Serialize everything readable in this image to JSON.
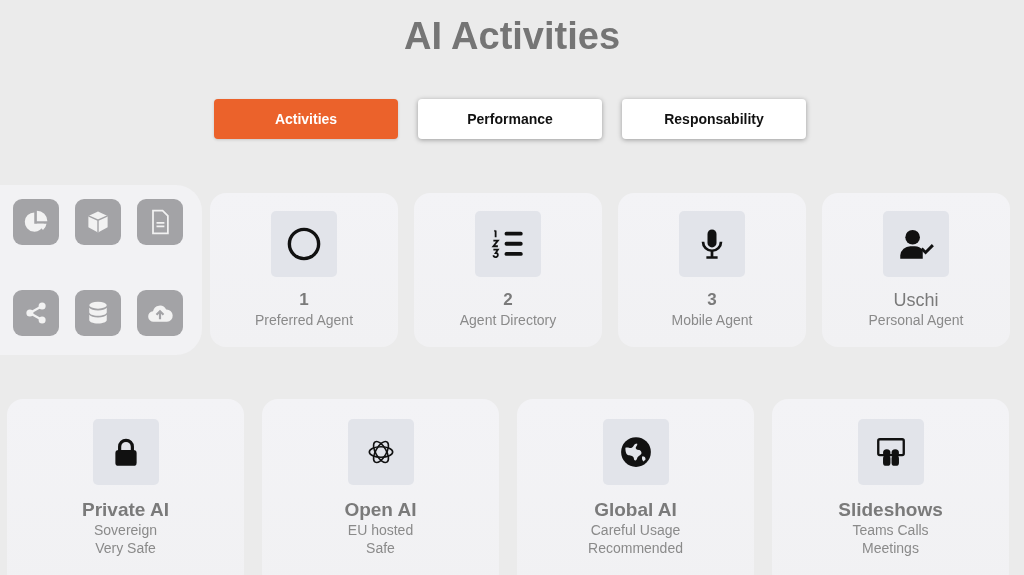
{
  "title": "AI Activities",
  "tabs": [
    {
      "label": "Activities",
      "selected": true
    },
    {
      "label": "Performance",
      "selected": false
    },
    {
      "label": "Responsability",
      "selected": false
    }
  ],
  "agents": [
    {
      "kind": "count",
      "title": "1",
      "lines": [
        "Preferred Agent"
      ]
    },
    {
      "kind": "count",
      "title": "2",
      "lines": [
        "Agent Directory"
      ]
    },
    {
      "kind": "count",
      "title": "3",
      "lines": [
        "Mobile Agent"
      ]
    },
    {
      "kind": "name",
      "title": "Uschi",
      "lines": [
        "Personal Agent"
      ]
    }
  ],
  "services": [
    {
      "kind": "count",
      "title": "Private AI",
      "lines": [
        "Sovereign",
        "Very Safe"
      ]
    },
    {
      "kind": "count",
      "title": "Open AI",
      "lines": [
        "EU hosted",
        "Safe"
      ]
    },
    {
      "kind": "count",
      "title": "Global AI",
      "lines": [
        "Careful Usage",
        "Recommended"
      ]
    },
    {
      "kind": "count",
      "title": "Slideshows",
      "lines": [
        "Teams Calls",
        "Meetings"
      ]
    }
  ]
}
